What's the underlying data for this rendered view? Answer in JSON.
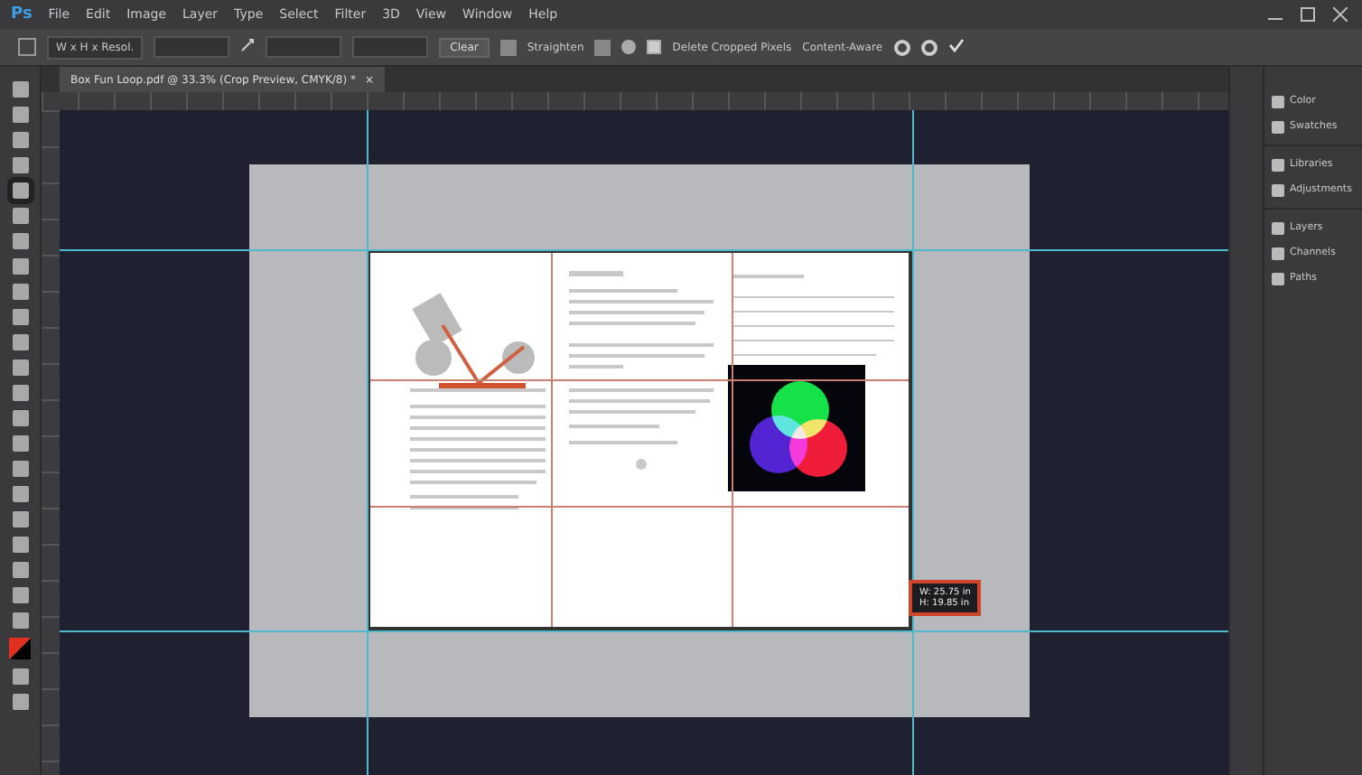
{
  "menu_bar": {
    "logo": "Ps",
    "items": [
      "File",
      "Edit",
      "Image",
      "Layer",
      "Type",
      "Select",
      "Filter",
      "3D",
      "View",
      "Window",
      "Help"
    ]
  },
  "options_bar": {
    "ratio": "W x H x Resol.",
    "clear": "Clear",
    "straighten": "Straighten",
    "delete_cropped": {
      "label": "Delete Cropped Pixels",
      "checked": true
    },
    "content_aware": "Content-Aware"
  },
  "document_tab": {
    "title": "Box Fun Loop.pdf @ 33.3% (Crop Preview, CMYK/8) *",
    "close": "×"
  },
  "crop_readout": {
    "lines": [
      "W: 25.75 in",
      "H: 19.85 in"
    ]
  },
  "panels": [
    {
      "label": "Color"
    },
    {
      "label": "Swatches"
    },
    {
      "label": "Libraries"
    },
    {
      "label": "Adjustments"
    },
    {
      "label": "Layers"
    },
    {
      "label": "Channels"
    },
    {
      "label": "Paths"
    }
  ]
}
